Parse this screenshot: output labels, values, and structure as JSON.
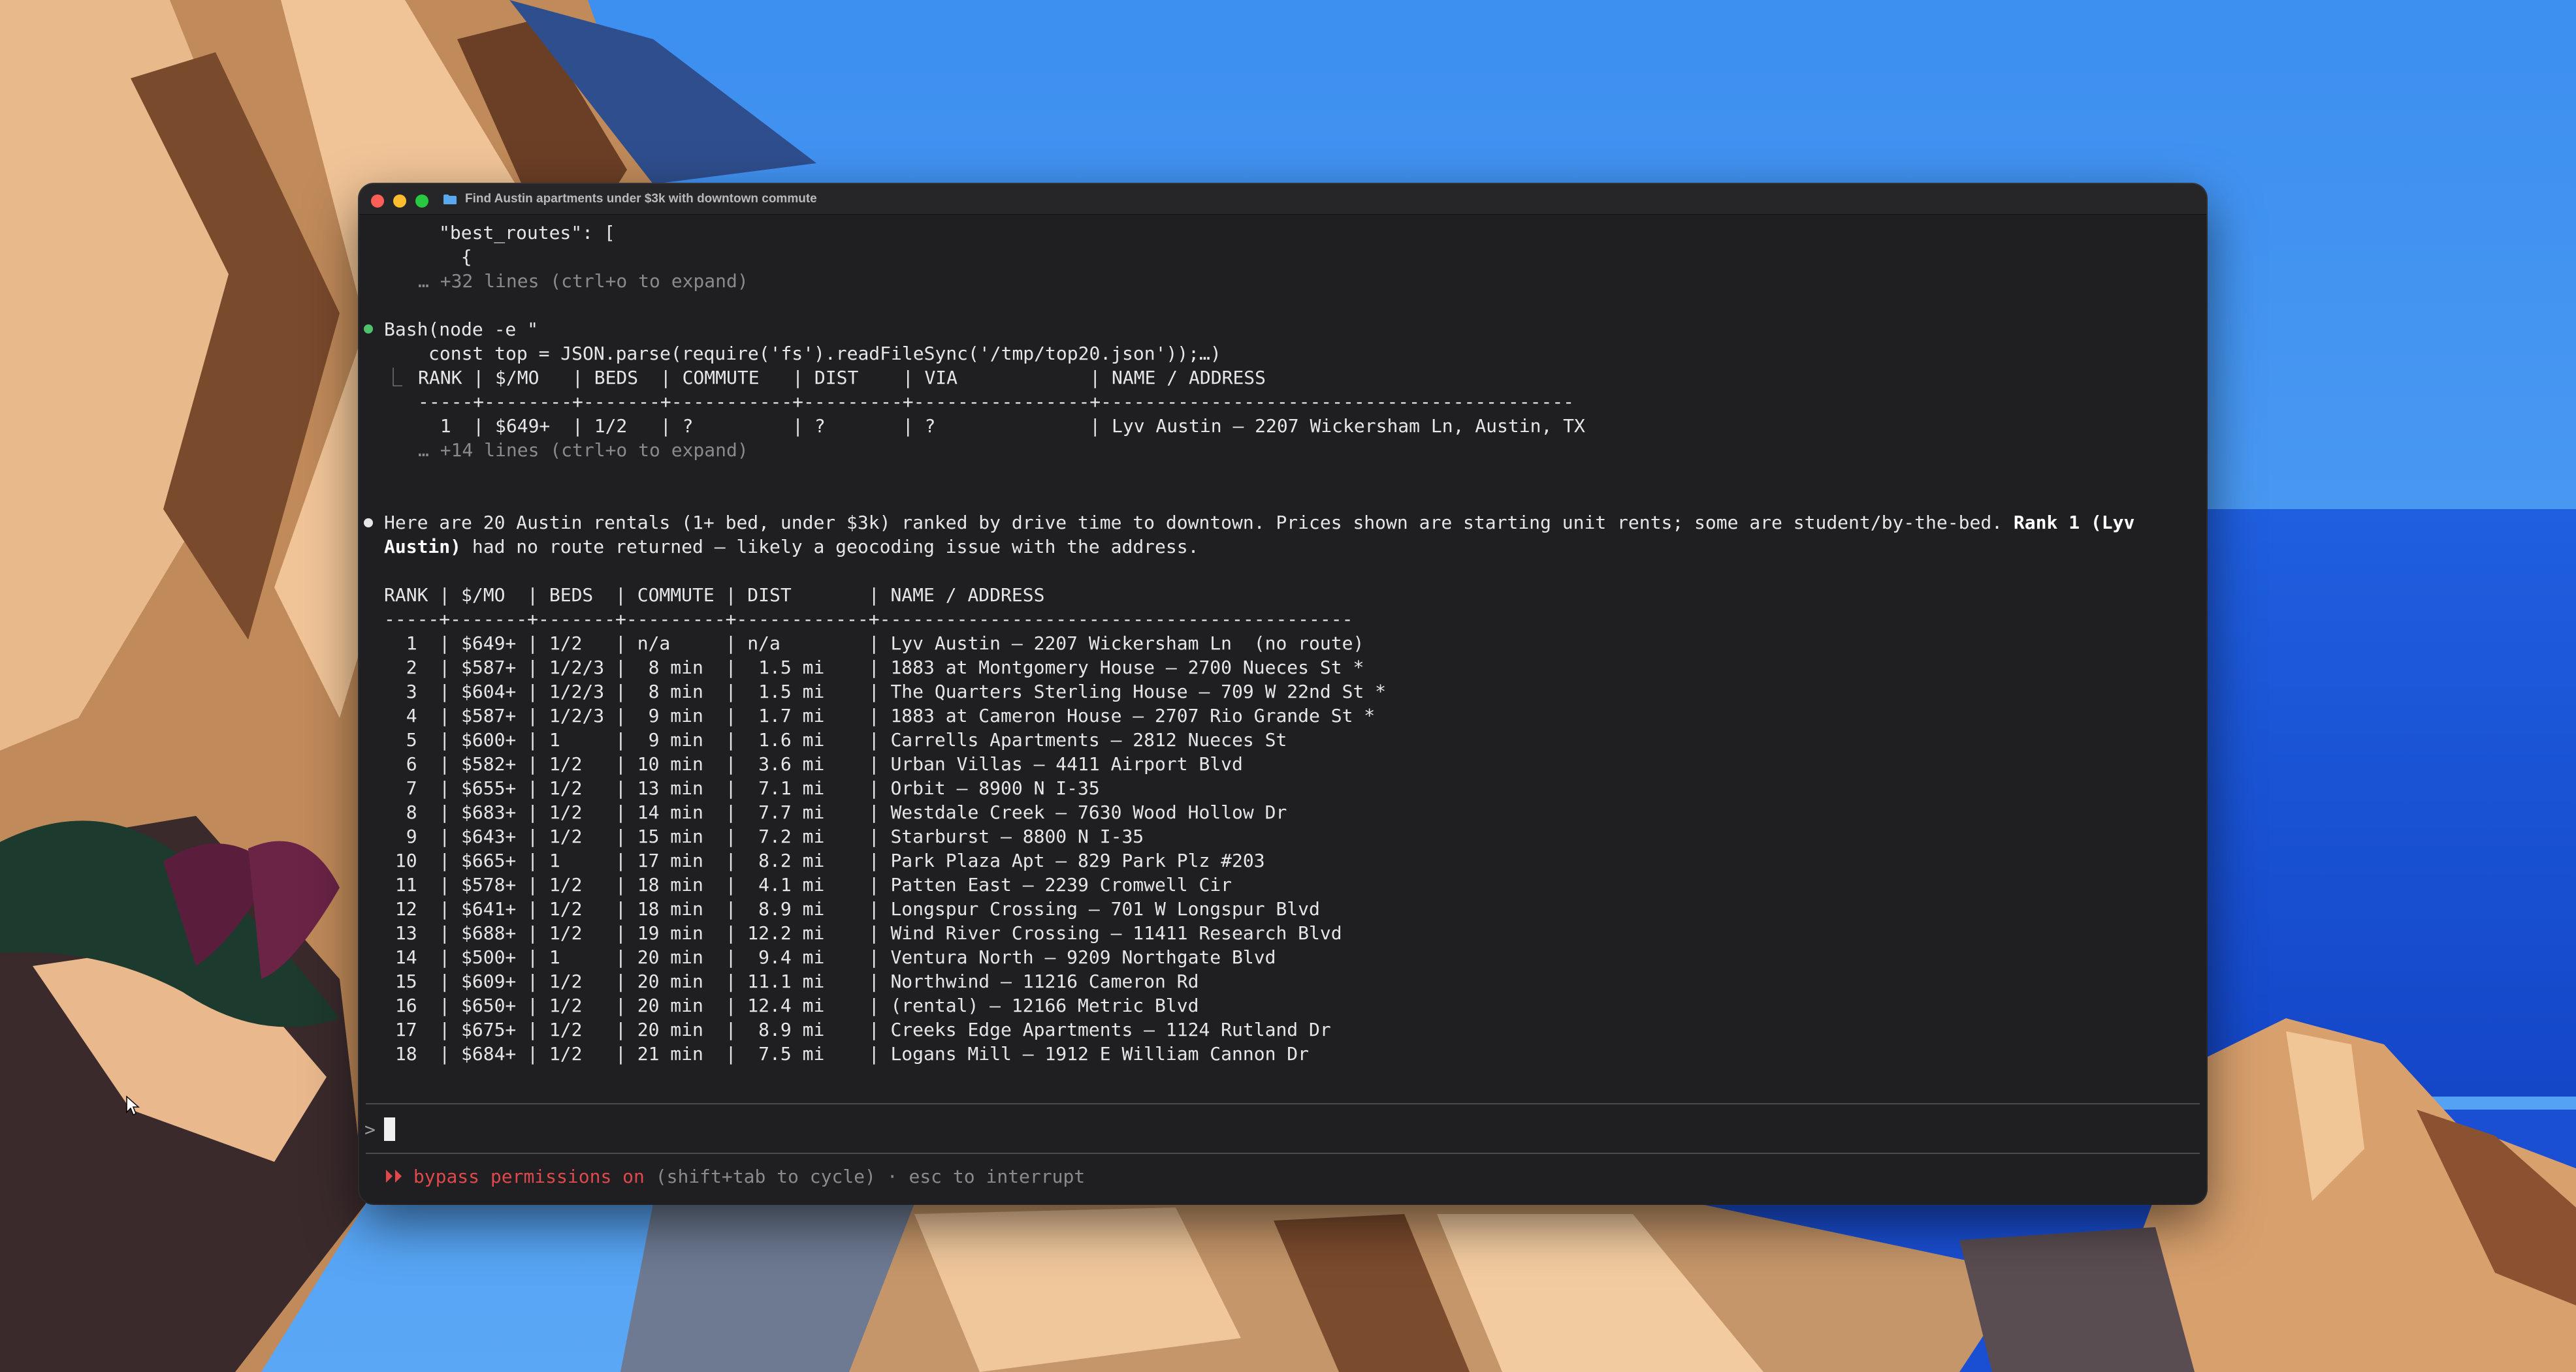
{
  "window": {
    "title": "Find Austin apartments under $3k with downtown commute"
  },
  "icons": {
    "folder": "folder-icon",
    "mouse": "mouse-pointer-icon"
  },
  "colors": {
    "green_dot": "#4fc16a",
    "permission_red": "#e0484c",
    "terminal_bg": "#1f1f21"
  },
  "terminal": {
    "json_preview": [
      "\"best_routes\": [",
      "  {"
    ],
    "json_more": "… +32 lines (ctrl+o to expand)",
    "bash_cmd": "Bash(node -e \"",
    "bash_cmd2": "const top = JSON.parse(require('fs').readFileSync('/tmp/top20.json'));…)",
    "bash_out_corner": "⎿",
    "bash_out_header": "RANK | $/MO   | BEDS  | COMMUTE   | DIST    | VIA            | NAME / ADDRESS",
    "bash_out_sep": "-----+--------+-------+-----------+---------+----------------+-------------------------------------------",
    "bash_out_row": "  1  | $649+  | 1/2   | ?         | ?       | ?              | Lyv Austin — 2207 Wickersham Ln, Austin, TX",
    "bash_more": "… +14 lines (ctrl+o to expand)",
    "summary_line1_a": "Here are 20 Austin rentals (1+ bed, under $3k) ranked by drive time to downtown. Prices shown are starting unit rents; some are student/by-the-bed. ",
    "summary_line1_b": "Rank 1 (Lyv",
    "summary_line2_a": "Austin)",
    "summary_line2_b": " had no route returned — likely a geocoding issue with the address.",
    "table_header": "RANK | $/MO  | BEDS  | COMMUTE | DIST       | NAME / ADDRESS",
    "table_sep": "-----+-------+-------+---------+------------+-------------------------------------------",
    "table_rows": [
      "  1  | $649+ | 1/2   | n/a     | n/a        | Lyv Austin — 2207 Wickersham Ln  (no route)",
      "  2  | $587+ | 1/2/3 |  8 min  |  1.5 mi    | 1883 at Montgomery House — 2700 Nueces St *",
      "  3  | $604+ | 1/2/3 |  8 min  |  1.5 mi    | The Quarters Sterling House — 709 W 22nd St *",
      "  4  | $587+ | 1/2/3 |  9 min  |  1.7 mi    | 1883 at Cameron House — 2707 Rio Grande St *",
      "  5  | $600+ | 1     |  9 min  |  1.6 mi    | Carrells Apartments — 2812 Nueces St",
      "  6  | $582+ | 1/2   | 10 min  |  3.6 mi    | Urban Villas — 4411 Airport Blvd",
      "  7  | $655+ | 1/2   | 13 min  |  7.1 mi    | Orbit — 8900 N I-35",
      "  8  | $683+ | 1/2   | 14 min  |  7.7 mi    | Westdale Creek — 7630 Wood Hollow Dr",
      "  9  | $643+ | 1/2   | 15 min  |  7.2 mi    | Starburst — 8800 N I-35",
      " 10  | $665+ | 1     | 17 min  |  8.2 mi    | Park Plaza Apt — 829 Park Plz #203",
      " 11  | $578+ | 1/2   | 18 min  |  4.1 mi    | Patten East — 2239 Cromwell Cir",
      " 12  | $641+ | 1/2   | 18 min  |  8.9 mi    | Longspur Crossing — 701 W Longspur Blvd",
      " 13  | $688+ | 1/2   | 19 min  | 12.2 mi    | Wind River Crossing — 11411 Research Blvd",
      " 14  | $500+ | 1     | 20 min  |  9.4 mi    | Ventura North — 9209 Northgate Blvd",
      " 15  | $609+ | 1/2   | 20 min  | 11.1 mi    | Northwind — 11216 Cameron Rd",
      " 16  | $650+ | 1/2   | 20 min  | 12.4 mi    | (rental) — 12166 Metric Blvd",
      " 17  | $675+ | 1/2   | 20 min  |  8.9 mi    | Creeks Edge Apartments — 1124 Rutland Dr",
      " 18  | $684+ | 1/2   | 21 min  |  7.5 mi    | Logans Mill — 1912 E William Cannon Dr"
    ],
    "prompt_caret": ">",
    "status_arrows": "⏵⏵",
    "status_perm": "bypass permissions on",
    "status_hint": "(shift+tab to cycle) · esc to interrupt"
  }
}
